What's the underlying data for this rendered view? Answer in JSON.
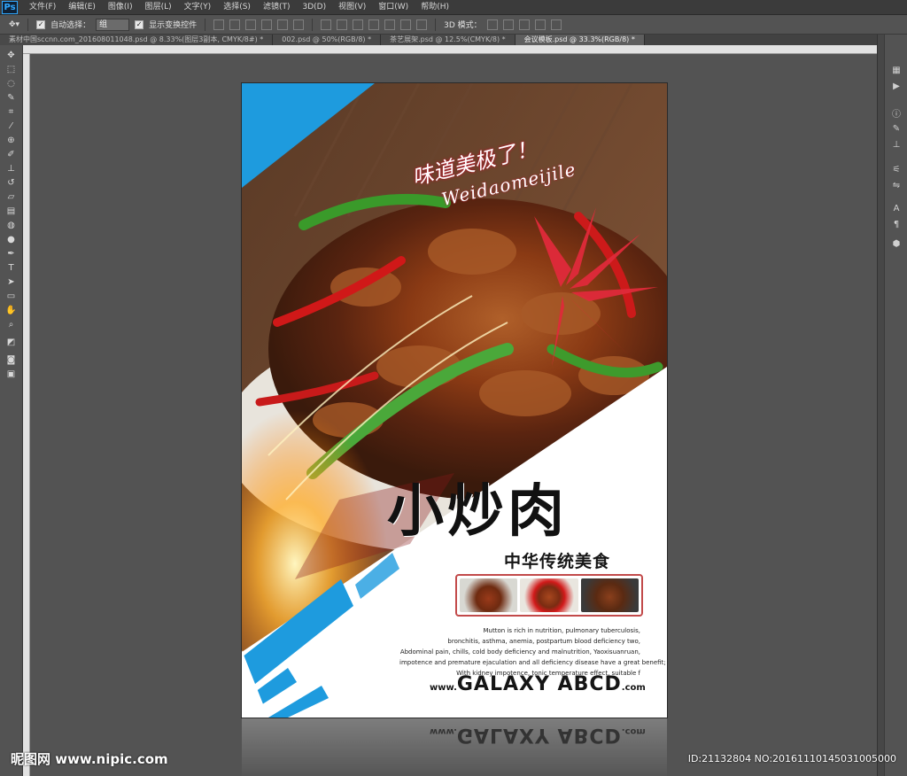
{
  "app": {
    "logo": "Ps"
  },
  "menu": [
    "文件(F)",
    "编辑(E)",
    "图像(I)",
    "图层(L)",
    "文字(Y)",
    "选择(S)",
    "滤镜(T)",
    "3D(D)",
    "视图(V)",
    "窗口(W)",
    "帮助(H)"
  ],
  "options": {
    "auto_select_label": "自动选择：",
    "auto_select_value": "组",
    "show_transform_label": "显示变换控件",
    "mode_3d_label": "3D 模式："
  },
  "tabs": [
    {
      "label": "素材中国sccnn.com_201608011048.psd @ 8.33%(图层3副本, CMYK/8#) *",
      "active": false
    },
    {
      "label": "002.psd @ 50%(RGB/8) *",
      "active": false
    },
    {
      "label": "茶艺展架.psd @ 12.5%(CMYK/8) *",
      "active": false
    },
    {
      "label": "会议模板.psd @ 33.3%(RGB/8) *",
      "active": true
    }
  ],
  "poster": {
    "script_cn": "味道美极了！",
    "script_en": "Weidaomeijile",
    "title": "小炒肉",
    "subtitle": "中华传统美食",
    "body_lines": [
      "Mutton is rich in nutrition, pulmonary tuberculosis,",
      "bronchitis, asthma, anemia, postpartum blood deficiency two,",
      "Abdominal pain, chills, cold body deficiency and malnutrition, Yaoxisuanruan,",
      "impotence and premature ejaculation and all deficiency disease have a great benefit;",
      "With kidney impotence, tonic temperature effect, suitable f"
    ],
    "footer": {
      "www": "www.",
      "brand": "GALAXY ABCD",
      "com": ".com"
    }
  },
  "watermark": {
    "left": "昵图网 www.nipic.com",
    "right": "ID:21132804 NO:20161110145031005000"
  },
  "colors": {
    "accent_blue": "#1e9bde",
    "title_black": "#111111",
    "frame_red": "#c24a4a"
  }
}
